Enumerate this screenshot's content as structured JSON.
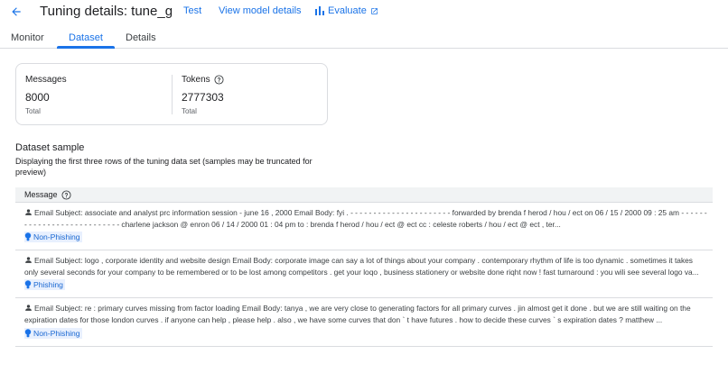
{
  "header": {
    "title": "Tuning details: tune_g",
    "links": {
      "test": "Test",
      "view_model": "View model details",
      "evaluate": "Evaluate"
    }
  },
  "tabs": [
    {
      "label": "Monitor",
      "active": false
    },
    {
      "label": "Dataset",
      "active": true
    },
    {
      "label": "Details",
      "active": false
    }
  ],
  "stats": {
    "messages": {
      "label": "Messages",
      "value": "8000",
      "sub": "Total"
    },
    "tokens": {
      "label": "Tokens",
      "value": "2777303",
      "sub": "Total"
    }
  },
  "dataset_sample": {
    "title": "Dataset sample",
    "description": "Displaying the first three rows of the tuning data set (samples may be truncated for preview)",
    "column_header": "Message",
    "rows": [
      {
        "text": "Email Subject: associate and analyst prc information session - june 16 , 2000 Email Body: fyi . - - - - - - - - - - - - - - - - - - - - - - forwarded by brenda f herod / hou / ect on 06 / 15 / 2000 09 : 25 am - - - - - - - - - - - - - - - - - - - - - - - - - - - charlene jackson @ enron 06 / 14 / 2000 01 : 04 pm to : brenda f herod / hou / ect @ ect cc : celeste roberts / hou / ect @ ect , ter...",
        "label": "Non-Phishing"
      },
      {
        "text": "Email Subject: logo , corporate identity and website design Email Body: corporate image can say a lot of things about your company . contemporary rhythm of life is too dynamic . sometimes it takes only several seconds for your company to be remembered or to be lost among competitors . get your loqo , business stationery or website done riqht now ! fast turnaround : you wili see several logo va...",
        "label": "Phishing"
      },
      {
        "text": "Email Subject: re : primary curves missing from factor loading Email Body: tanya , we are very close to generating factors for all primary curves . jin almost get it done . but we are still waiting on the expiration dates for those london curves . if anyone can help , please help . also , we have some curves that don ` t have futures . how to decide these curves ` s expiration dates ? matthew ...",
        "label": "Non-Phishing"
      }
    ]
  },
  "colors": {
    "accent": "#1a73e8",
    "chip_bg": "#e8f0fe",
    "chip_text": "#1967d2",
    "header_bg": "#f1f3f4"
  }
}
